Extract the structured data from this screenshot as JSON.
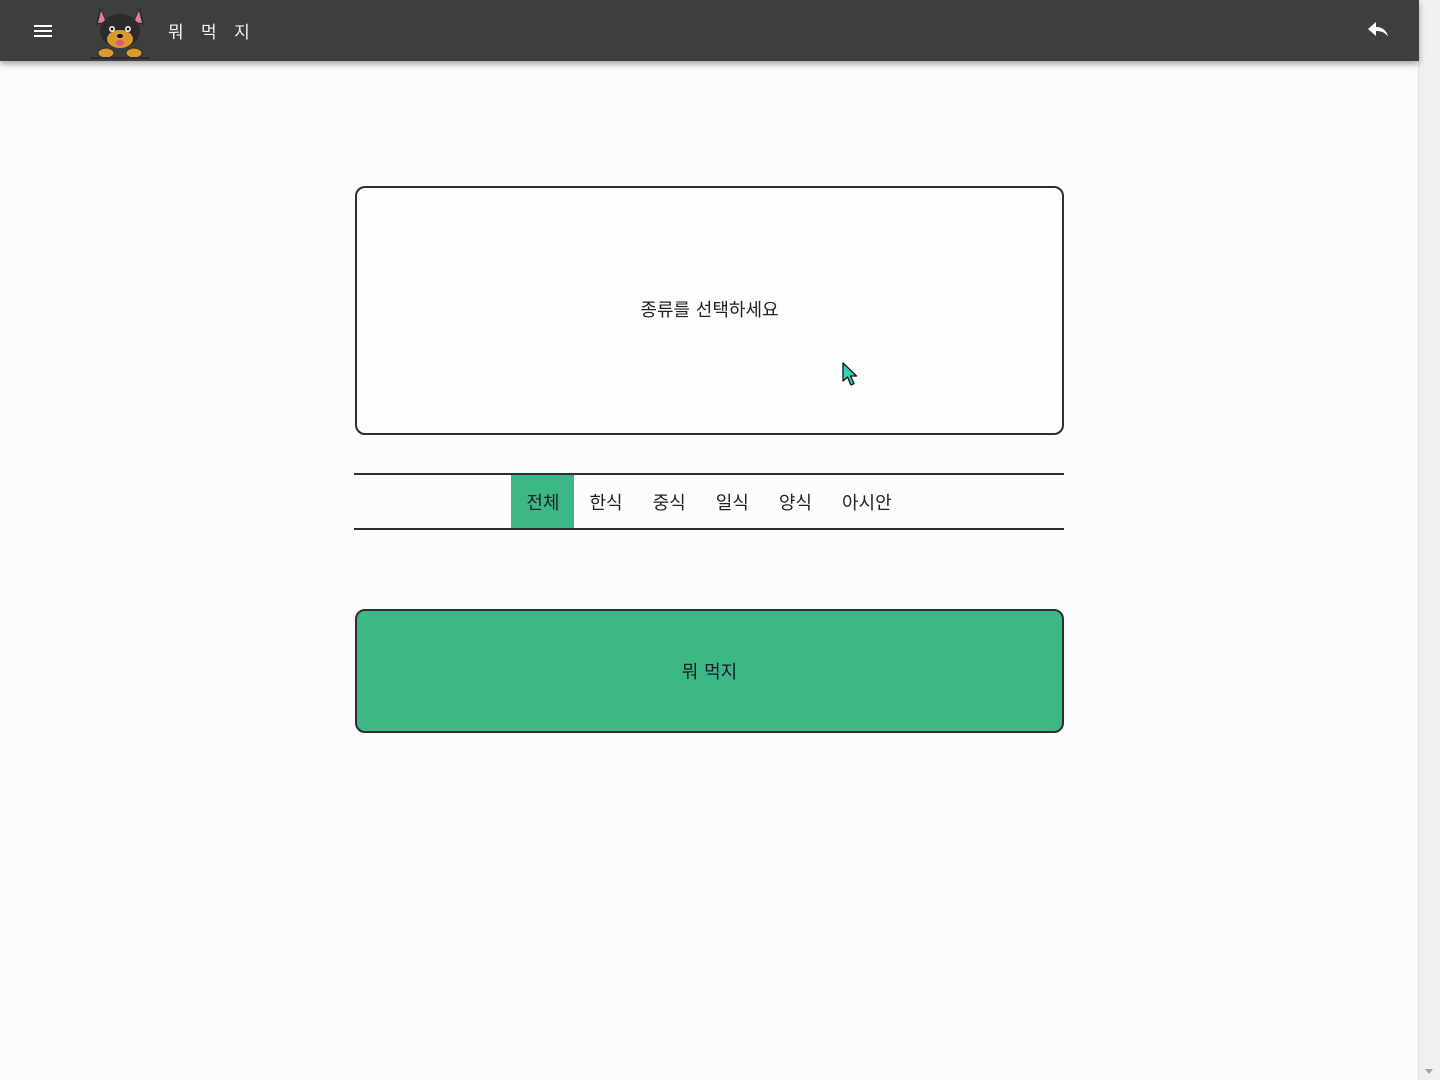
{
  "header": {
    "title": "뭐 먹 지",
    "menu_icon": "hamburger-menu-icon",
    "logo_icon": "dog-logo-icon",
    "back_icon": "reply-arrow-icon",
    "background": "#3e3e3e"
  },
  "display": {
    "prompt": "종류를 선택하세요"
  },
  "tabs": [
    {
      "label": "전체",
      "active": true
    },
    {
      "label": "한식",
      "active": false
    },
    {
      "label": "중식",
      "active": false
    },
    {
      "label": "일식",
      "active": false
    },
    {
      "label": "양식",
      "active": false
    },
    {
      "label": "아시안",
      "active": false
    }
  ],
  "action": {
    "label": "뭐 먹지"
  },
  "colors": {
    "accent": "#3cb887",
    "border": "#2e2e2e",
    "page": "#fcfcfc"
  }
}
